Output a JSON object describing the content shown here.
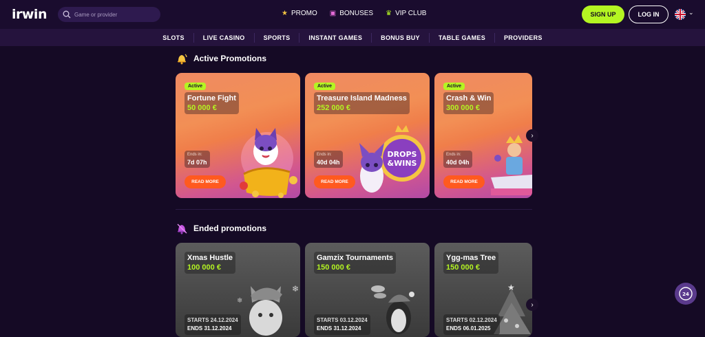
{
  "header": {
    "logo": "irwin",
    "search_placeholder": "Game or provider",
    "nav": [
      {
        "label": "PROMO",
        "icon": "star-icon",
        "glyph": "★",
        "color": "#f5c542"
      },
      {
        "label": "BONUSES",
        "icon": "gift-icon",
        "glyph": "🎁",
        "color": "#e36ad6"
      },
      {
        "label": "VIP CLUB",
        "icon": "crown-icon",
        "glyph": "♛",
        "color": "#b4f522"
      }
    ],
    "signup_label": "SIGN UP",
    "login_label": "LOG IN"
  },
  "categories": [
    "SLOTS",
    "LIVE CASINO",
    "SPORTS",
    "INSTANT GAMES",
    "BONUS BUY",
    "TABLE GAMES",
    "PROVIDERS"
  ],
  "active_section": {
    "title": "Active Promotions",
    "cards": [
      {
        "badge": "Active",
        "title": "Fortune Fight",
        "amount": "50 000 €",
        "ends_label": "Ends in:",
        "ends_value": "7d  07h",
        "button": "READ MORE"
      },
      {
        "badge": "Active",
        "title": "Treasure Island Madness",
        "amount": "252 000 €",
        "ends_label": "Ends in:",
        "ends_value": "40d 04h",
        "button": "READ MORE",
        "art_text": "DROPS &WINS"
      },
      {
        "badge": "Active",
        "title": "Crash & Win",
        "amount": "300 000 €",
        "ends_label": "Ends in:",
        "ends_value": "40d 04h",
        "button": "READ MORE"
      }
    ]
  },
  "ended_section": {
    "title": "Ended promotions",
    "cards": [
      {
        "title": "Xmas Hustle",
        "amount": "100 000 €",
        "starts": "STARTS 24.12.2024",
        "ends": "ENDS 31.12.2024"
      },
      {
        "title": "Gamzix Tournaments",
        "amount": "150 000 €",
        "starts": "STARTS 03.12.2024",
        "ends": "ENDS 31.12.2024"
      },
      {
        "title": "Ygg-mas Tree",
        "amount": "150 000 €",
        "starts": "STARTS 02.12.2024",
        "ends": "ENDS 06.01.2025"
      }
    ]
  },
  "support_label": "24",
  "colors": {
    "accent": "#b4f522",
    "button_orange": "#ff5a1f",
    "bg": "#150a25"
  }
}
